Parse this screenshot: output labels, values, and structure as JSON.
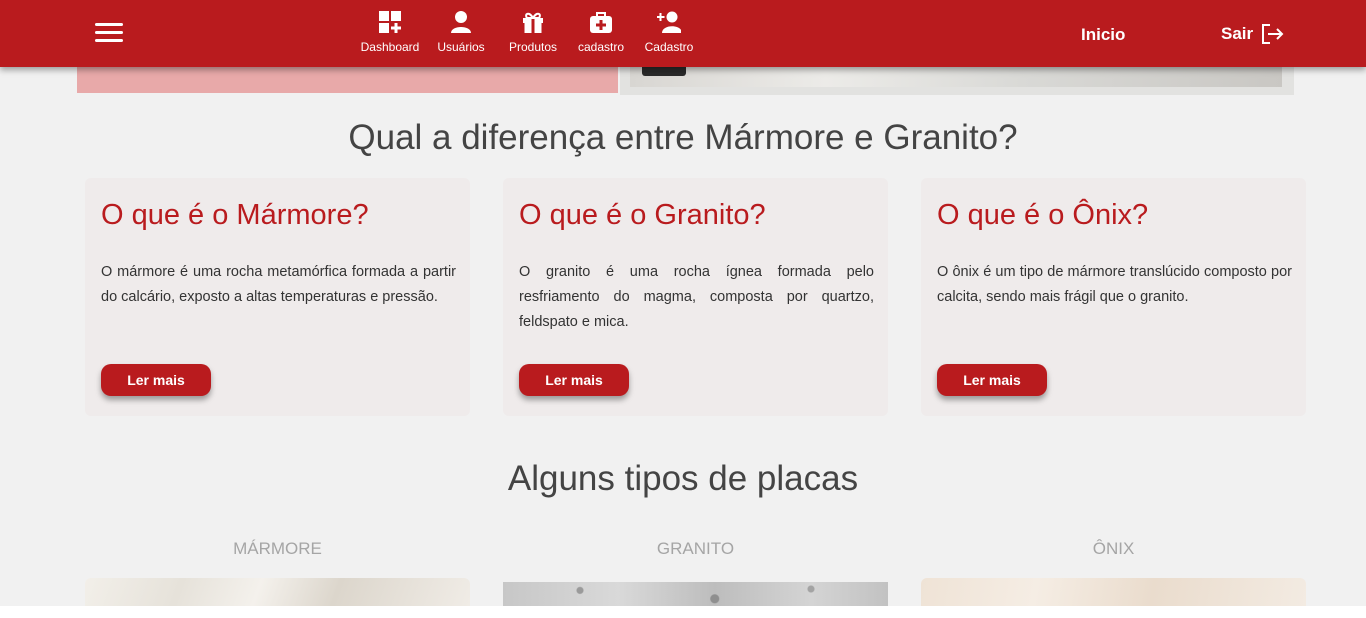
{
  "navbar": {
    "items": [
      {
        "label": "Dashboard",
        "icon": "dashboard-icon"
      },
      {
        "label": "Usuários",
        "icon": "user-icon"
      },
      {
        "label": "Produtos",
        "icon": "gift-icon"
      },
      {
        "label": "cadastro",
        "icon": "medical-bag-icon"
      },
      {
        "label": "Cadastro",
        "icon": "user-plus-icon"
      }
    ],
    "inicio_label": "Inicio",
    "sair_label": "Sair"
  },
  "section_differences": {
    "title": "Qual a diferença entre Mármore e Granito?",
    "cards": [
      {
        "heading": "O que é o Mármore?",
        "text": "O mármore é uma rocha metamórfica formada a partir do calcário, exposto a altas temperaturas e pressão.",
        "button": "Ler mais"
      },
      {
        "heading": "O que é o Granito?",
        "text": "O granito é uma rocha ígnea formada pelo resfriamento do magma, composta por quartzo, feldspato e mica.",
        "button": "Ler mais"
      },
      {
        "heading": "O que é o Ônix?",
        "text": "O ônix é um tipo de mármore translúcido composto por calcita, sendo mais frágil que o granito.",
        "button": "Ler mais"
      }
    ]
  },
  "section_types": {
    "title": "Alguns tipos de placas",
    "types": [
      "MÁRMORE",
      "GRANITO",
      "ÔNIX"
    ]
  },
  "colors": {
    "brand_red": "#b91b1e",
    "background": "#f1f1f1",
    "card_background": "#efebeb"
  }
}
